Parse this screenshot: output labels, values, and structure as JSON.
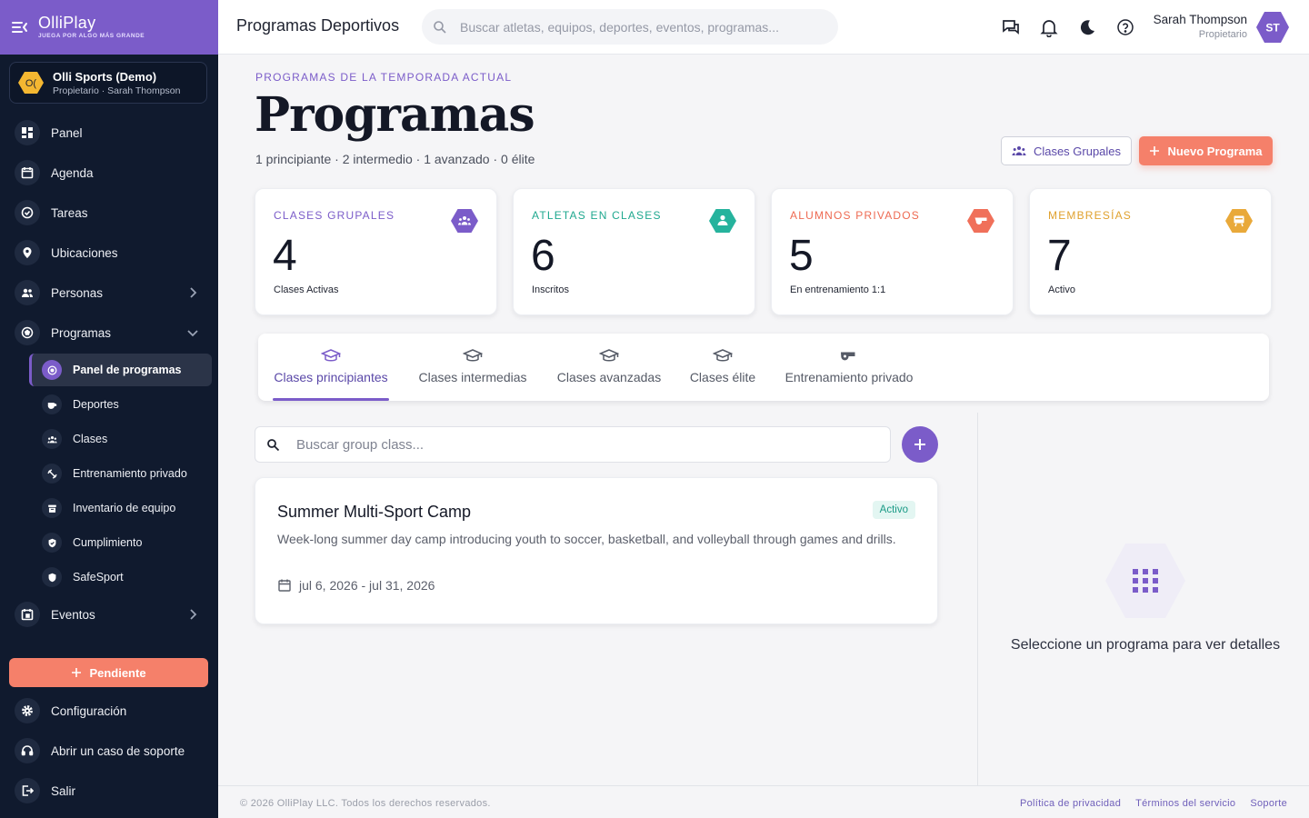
{
  "brand": {
    "name": "OlliPlay",
    "tagline": "JUEGA POR ALGO MÁS GRANDE"
  },
  "org": {
    "initials": "O(",
    "name": "Olli Sports (Demo)",
    "role": "Propietario · Sarah Thompson"
  },
  "nav": {
    "panel": "Panel",
    "agenda": "Agenda",
    "tareas": "Tareas",
    "ubicaciones": "Ubicaciones",
    "personas": "Personas",
    "programas": "Programas",
    "sub": {
      "panel_programas": "Panel de programas",
      "deportes": "Deportes",
      "clases": "Clases",
      "entrenamiento": "Entrenamiento privado",
      "inventario": "Inventario de equipo",
      "cumplimiento": "Cumplimiento",
      "safesport": "SafeSport"
    },
    "eventos": "Eventos",
    "pending": "Pendiente",
    "configuracion": "Configuración",
    "soporte": "Abrir un caso de soporte",
    "salir": "Salir"
  },
  "topbar": {
    "title": "Programas Deportivos",
    "search_placeholder": "Buscar atletas, equipos, deportes, eventos, programas...",
    "user_name": "Sarah Thompson",
    "user_role": "Propietario",
    "user_initials": "ST"
  },
  "header": {
    "eyebrow": "PROGRAMAS DE LA TEMPORADA ACTUAL",
    "title": "Programas",
    "levels": "1 principiante · 2 intermedio · 1 avanzado · 0 élite",
    "btn_group": "Clases Grupales",
    "btn_new": "Nuevo Programa"
  },
  "stats": [
    {
      "label": "CLASES GRUPALES",
      "value": "4",
      "sub": "Clases Activas",
      "color": "#7b5cc9",
      "icon": "group-icon"
    },
    {
      "label": "ATLETAS EN CLASES",
      "value": "6",
      "sub": "Inscritos",
      "color": "#26b39d",
      "icon": "person-icon"
    },
    {
      "label": "ALUMNOS PRIVADOS",
      "value": "5",
      "sub": "En entrenamiento 1:1",
      "color": "#f0705a",
      "icon": "whistle-icon"
    },
    {
      "label": "MEMBRESÍAS",
      "value": "7",
      "sub": "Activo",
      "color": "#e9a93a",
      "icon": "card-icon"
    }
  ],
  "tabs": [
    {
      "label": "Clases principiantes",
      "active": true
    },
    {
      "label": "Clases intermedias"
    },
    {
      "label": "Clases avanzadas"
    },
    {
      "label": "Clases élite"
    },
    {
      "label": "Entrenamiento privado"
    }
  ],
  "list": {
    "search_placeholder": "Buscar group class...",
    "items": [
      {
        "title": "Summer Multi-Sport Camp",
        "status": "Activo",
        "description": "Week-long summer day camp introducing youth to soccer, basketball, and volleyball through games and drills.",
        "dates": "jul 6, 2026 - jul 31, 2026"
      }
    ]
  },
  "detail": {
    "empty_text": "Seleccione un programa para ver detalles"
  },
  "footer": {
    "copyright": "© 2026 OlliPlay LLC. Todos los derechos reservados.",
    "links": [
      "Política de privacidad",
      "Términos del servicio",
      "Soporte"
    ]
  },
  "colors": {
    "accent": "#7b5cc9",
    "cta": "#f5806a",
    "sidebar": "#101a2e"
  }
}
